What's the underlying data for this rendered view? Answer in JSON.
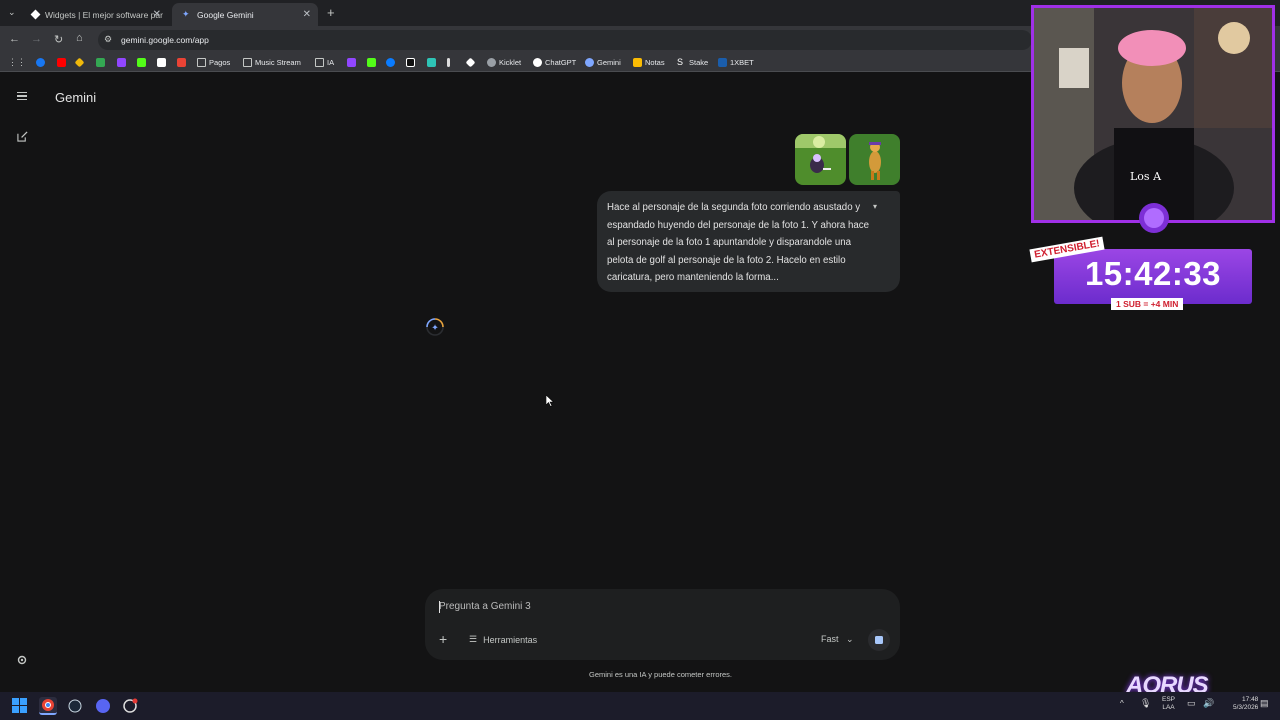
{
  "browser": {
    "tabs": [
      {
        "title": "Widgets | El mejor software par"
      },
      {
        "title": "Google Gemini"
      }
    ],
    "url": "gemini.google.com/app",
    "bookmarks": [
      "Pagos",
      "Music Stream",
      "IA",
      "Kicklet",
      "ChatGPT",
      "Gemini",
      "Notas",
      "Stake",
      "1XBET"
    ]
  },
  "gemini": {
    "title": "Gemini",
    "message": "Hace al personaje de la segunda foto corriendo asustado y espandado huyendo del personaje de la foto 1. Y ahora hace al personaje de la foto 1 apuntandole y disparandole una pelota de golf al personaje de la foto 2. Hacelo en estilo caricatura, pero manteniendo la forma...",
    "prompt_placeholder": "Pregunta a Gemini 3",
    "tools_label": "Herramientas",
    "model_label": "Fast",
    "disclaimer": "Gemini es una IA y puede cometer errores."
  },
  "overlay": {
    "badge": "EXTENSIBLE!",
    "timer": "15:42:33",
    "sub_note": "1 SUB = +4 MIN",
    "brand": "AORUS",
    "webcam_shirt_text": "Los A"
  },
  "taskbar": {
    "lang_top": "ESP",
    "lang_bottom": "LAA",
    "time": "17:48",
    "date": "5/3/2026"
  },
  "colors": {
    "background": "#131314",
    "accent_purple": "#9b46e5",
    "stop_blue": "#a8c7fa"
  }
}
